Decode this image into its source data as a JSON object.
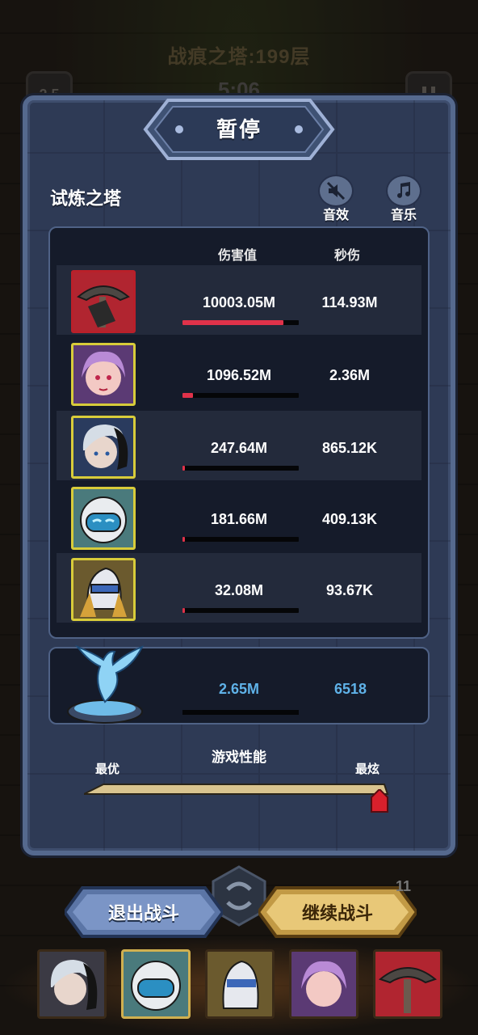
{
  "top": {
    "title": "战痕之塔:199层",
    "timer": "5:06",
    "left_button": "2.5"
  },
  "dialog": {
    "title": "暂停",
    "tower_name": "试炼之塔",
    "sound_label": "音效",
    "music_label": "音乐"
  },
  "stats": {
    "header_damage": "伤害值",
    "header_dps": "秒伤",
    "rows": [
      {
        "hero": "umbrella-hero",
        "damage": "10003.05M",
        "dps": "114.93M",
        "share": 0.87
      },
      {
        "hero": "purple-hair-hero",
        "damage": "1096.52M",
        "dps": "2.36M",
        "share": 0.09
      },
      {
        "hero": "silver-hair-hero",
        "damage": "247.64M",
        "dps": "865.12K",
        "share": 0.02
      },
      {
        "hero": "robot-hero",
        "damage": "181.66M",
        "dps": "409.13K",
        "share": 0.015
      },
      {
        "hero": "knight-hero",
        "damage": "32.08M",
        "dps": "93.67K",
        "share": 0.003
      }
    ]
  },
  "pet": {
    "name": "phoenix-pet",
    "damage": "2.65M",
    "dps": "6518"
  },
  "performance": {
    "title": "游戏性能",
    "min_label": "最优",
    "max_label": "最炫",
    "level": 1.0
  },
  "buttons": {
    "exit": "退出战斗",
    "continue": "继续战斗"
  },
  "coin_count": "11",
  "colors": {
    "panel": "#2e3a55",
    "panel_border": "#55698e",
    "damage_bar": "#e0324a",
    "pet_text": "#5fb2e8",
    "continue_button": "#d9b35a",
    "exit_button": "#5b75a6"
  }
}
